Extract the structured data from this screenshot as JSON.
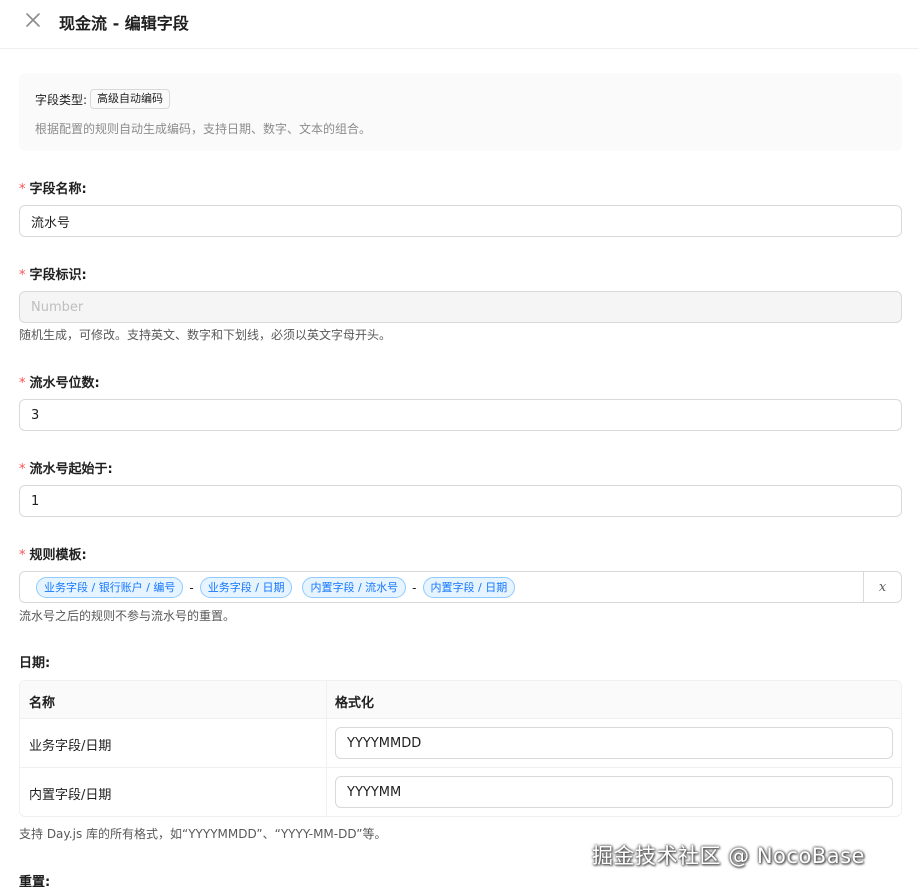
{
  "header": {
    "title": "现金流 - 编辑字段"
  },
  "field_type": {
    "label": "字段类型:",
    "value": "高级自动编码",
    "description": "根据配置的规则自动生成编码，支持日期、数字、文本的组合。"
  },
  "field_name": {
    "required_mark": "*",
    "label": "字段名称:",
    "value": "流水号"
  },
  "field_key": {
    "required_mark": "*",
    "label": "字段标识:",
    "placeholder": "Number",
    "help": "随机生成，可修改。支持英文、数字和下划线，必须以英文字母开头。"
  },
  "serial_digits": {
    "required_mark": "*",
    "label": "流水号位数:",
    "value": "3"
  },
  "serial_start": {
    "required_mark": "*",
    "label": "流水号起始于:",
    "value": "1"
  },
  "rule_template": {
    "required_mark": "*",
    "label": "规则模板:",
    "items": [
      "业务字段 / 银行账户 / 编号",
      "-",
      "业务字段 / 日期",
      "内置字段 / 流水号",
      "-",
      "内置字段 / 日期"
    ],
    "x_button": "x",
    "help": "流水号之后的规则不参与流水号的重置。"
  },
  "date_section": {
    "label": "日期:",
    "columns": [
      "名称",
      "格式化"
    ],
    "rows": [
      {
        "name": "业务字段/日期",
        "format": "YYYYMMDD"
      },
      {
        "name": "内置字段/日期",
        "format": "YYYYMM"
      }
    ],
    "help": "支持 Day.js 库的所有格式，如“YYYYMMDD”、“YYYY-MM-DD”等。"
  },
  "reset_section": {
    "label": "重置:"
  },
  "watermark": "掘金技术社区 @ NocoBase"
}
